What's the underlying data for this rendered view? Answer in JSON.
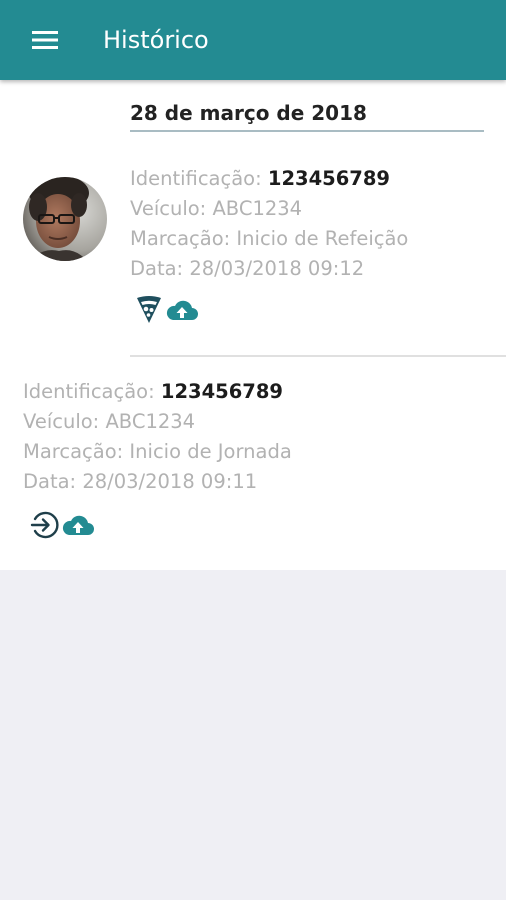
{
  "app_bar": {
    "title": "Histórico",
    "menu_icon": "hamburger-menu-icon",
    "color": "#238b92"
  },
  "date_header": "28 de março de 2018",
  "entries": [
    {
      "id_label": "Identificação:",
      "id_value": "123456789",
      "vehicle_label": "Veículo:",
      "vehicle_value": "ABC1234",
      "mark_label": "Marcação:",
      "mark_value": "Inicio de Refeição",
      "date_label": "Data:",
      "date_value": "28/03/2018 09:12",
      "has_photo": true,
      "type_icon": "pizza-slice-icon",
      "status_icon": "cloud-upload-icon"
    },
    {
      "id_label": "Identificação:",
      "id_value": "123456789",
      "vehicle_label": "Veículo:",
      "vehicle_value": "ABC1234",
      "mark_label": "Marcação:",
      "mark_value": "Inicio de Jornada",
      "date_label": "Data:",
      "date_value": "28/03/2018 09:11",
      "has_photo": false,
      "type_icon": "login-arrow-icon",
      "status_icon": "cloud-upload-icon"
    }
  ],
  "colors": {
    "accent": "#238b92",
    "icon_dark": "#1f4f5e",
    "muted_text": "#b2b2b2",
    "page_background": "#efeff4"
  }
}
